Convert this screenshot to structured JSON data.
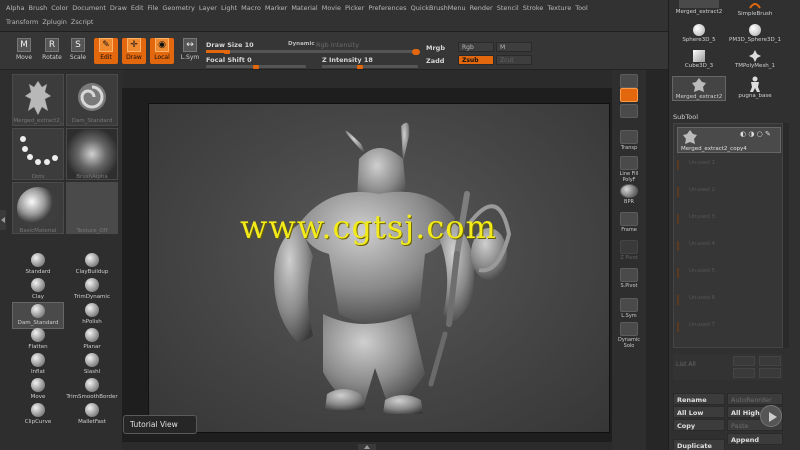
{
  "menubar": {
    "row1": [
      "Alpha",
      "Brush",
      "Color",
      "Document",
      "Draw",
      "Edit",
      "File",
      "Geometry",
      "Layer",
      "Light",
      "Macro",
      "Marker",
      "Material",
      "Movie",
      "Picker",
      "Preferences",
      "QuickBrushMenu",
      "Render",
      "Stencil",
      "Stroke",
      "Texture",
      "Tool"
    ],
    "row2": [
      "Transform",
      "Zplugin",
      "Zscript"
    ]
  },
  "toolbar": {
    "move": "Move",
    "rotate": "Rotate",
    "scale": "Scale",
    "edit": "Edit",
    "draw": "Draw",
    "local": "Local",
    "lsym": "L.Sym",
    "draw_size_label": "Draw Size",
    "draw_size_value": "10",
    "dynamic": "Dynamic",
    "rgb_intensity": "Rgb Intensity",
    "focal_shift_label": "Focal Shift",
    "focal_shift_value": "0",
    "z_intensity_label": "Z Intensity",
    "z_intensity_value": "18",
    "mrgb": "Mrgb",
    "rgb": "Rgb",
    "m": "M",
    "zadd": "Zadd",
    "zsub": "Zsub",
    "zcut": "Zcut",
    "accent": "#e2670d",
    "draw_size_level": 0.1,
    "focal_shift_level": 0.5,
    "z_intensity_level": 0.18
  },
  "leftpanel": {
    "thumbs": [
      {
        "label": "Merged_extract2_"
      },
      {
        "label": "Dam_Standard"
      },
      {
        "label": "Dots"
      },
      {
        "label": "BrushAlpha"
      },
      {
        "label": "BasicMaterial"
      },
      {
        "label": "Texture_Off"
      }
    ],
    "brushes": [
      "Standard",
      "ClayBuildup",
      "Clay",
      "TrimDynamic",
      "Dam_Standard",
      "hPolish",
      "Flatten",
      "Planar",
      "Inflat",
      "SlashI",
      "Move",
      "TrimSmoothBorder",
      "ClipCurve",
      "MalletFast"
    ]
  },
  "viewport": {
    "watermark": "www.cgtsj.com",
    "tutorial_view": "Tutorial View"
  },
  "rightbar": {
    "items": [
      "xyz",
      "",
      "",
      "Transp",
      "Line Fill PolyF",
      "BPR",
      "Frame",
      "Z Pivot",
      "S.Pivot",
      "L.Sym",
      "Dynamic Solo"
    ]
  },
  "rightpanel": {
    "tools": [
      {
        "label": "Merged_extract2"
      },
      {
        "label": "SimpleBrush"
      },
      {
        "label": "Sphere3D_5"
      },
      {
        "label": "PM3D_Sphere3D_1"
      },
      {
        "label": "Cube3D_3"
      },
      {
        "label": "TMPolyMesh_1"
      },
      {
        "label": "Merged_extract2"
      },
      {
        "label": "pugna_base"
      }
    ],
    "subtool_header": "SubTool",
    "subtool_active": "Merged_extract2_copy4",
    "subtool_empty": [
      "Unused 1",
      "Unused 2",
      "Unused 3",
      "Unused 4",
      "Unused 5",
      "Unused 6",
      "Unused 7"
    ],
    "list_all": "List All",
    "buttons": {
      "rename": "Rename",
      "autoreorder": "AutoReorder",
      "all_low": "All Low",
      "all_high": "All High",
      "copy": "Copy",
      "paste": "Paste",
      "duplicate": "Duplicate",
      "append": "Append"
    }
  }
}
